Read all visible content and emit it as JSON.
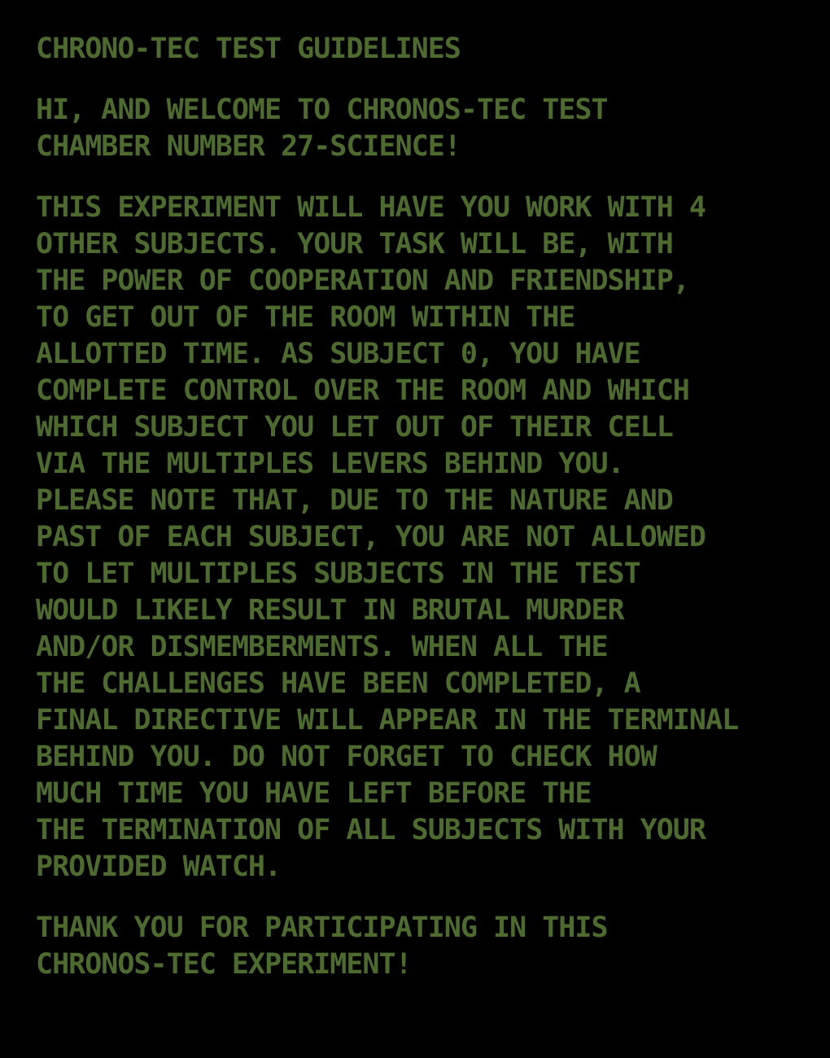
{
  "colors": {
    "background": "#000000",
    "text": "#4d6b2f"
  },
  "document": {
    "title": "CHRONO-TEC TEST GUIDELINES",
    "welcome_lines": [
      "HI, AND WELCOME TO CHRONOS-TEC TEST",
      "CHAMBER NUMBER 27-SCIENCE!"
    ],
    "body_lines": [
      "THIS EXPERIMENT WILL HAVE YOU WORK WITH 4",
      "OTHER SUBJECTS. YOUR TASK WILL BE, WITH",
      "THE POWER OF COOPERATION AND FRIENDSHIP,",
      "TO GET OUT OF THE ROOM WITHIN THE",
      "ALLOTTED TIME. AS SUBJECT 0, YOU HAVE",
      "COMPLETE CONTROL OVER THE ROOM AND WHICH",
      "WHICH SUBJECT YOU LET OUT OF THEIR CELL",
      "VIA THE MULTIPLES LEVERS BEHIND YOU.",
      "PLEASE NOTE THAT, DUE TO THE NATURE AND",
      "PAST OF EACH SUBJECT, YOU ARE NOT ALLOWED",
      "TO LET MULTIPLES SUBJECTS IN THE TEST",
      "WOULD LIKELY RESULT IN BRUTAL MURDER",
      "AND/OR DISMEMBERMENTS. WHEN ALL THE",
      "THE CHALLENGES HAVE BEEN COMPLETED, A",
      "FINAL DIRECTIVE WILL APPEAR IN THE TERMINAL",
      "BEHIND YOU. DO NOT FORGET TO CHECK HOW",
      "MUCH TIME YOU HAVE LEFT BEFORE THE",
      "THE TERMINATION OF ALL SUBJECTS WITH YOUR",
      "PROVIDED WATCH."
    ],
    "closing_lines": [
      "THANK YOU FOR PARTICIPATING IN THIS",
      "CHRONOS-TEC EXPERIMENT!"
    ]
  }
}
